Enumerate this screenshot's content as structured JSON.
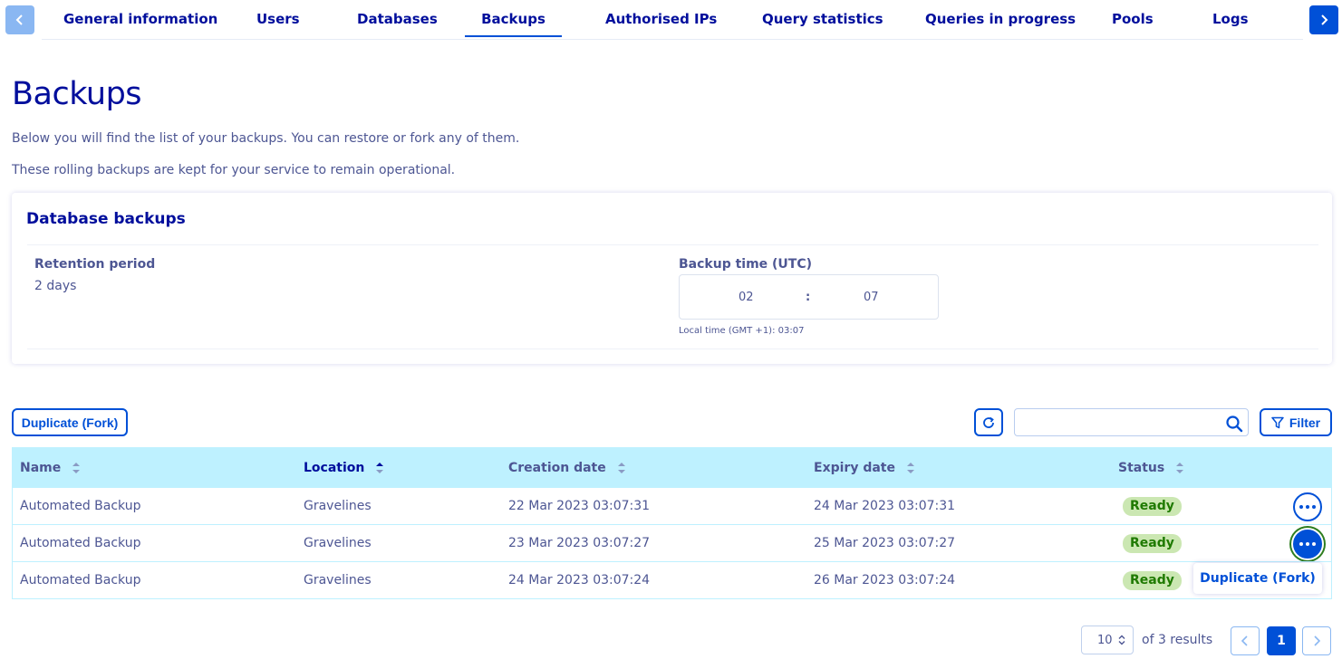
{
  "tabs": [
    "General information",
    "Users",
    "Databases",
    "Backups",
    "Authorised IPs",
    "Query statistics",
    "Queries in progress",
    "Pools",
    "Logs"
  ],
  "active_tab": "Backups",
  "page": {
    "title": "Backups",
    "description_1": "Below you will find the list of your backups. You can restore or fork any of them.",
    "description_2": "These rolling backups are kept for your service to remain operational."
  },
  "card": {
    "title": "Database backups",
    "retention_label": "Retention period",
    "retention_value": "2 days",
    "backup_time_label": "Backup time (UTC)",
    "backup_hour": "02",
    "time_separator": ":",
    "backup_minute": "07",
    "local_time": "Local time (GMT +1): 03:07"
  },
  "toolbar": {
    "fork_button": "Duplicate (Fork)",
    "search_placeholder": "",
    "filter_button": "Filter"
  },
  "table": {
    "headers": [
      "Name",
      "Location",
      "Creation date",
      "Expiry date",
      "Status"
    ],
    "sorted_column": "Location",
    "rows": [
      {
        "name": "Automated Backup",
        "location": "Gravelines",
        "created": "22 Mar 2023 03:07:31",
        "expires": "24 Mar 2023 03:07:31",
        "status": "Ready"
      },
      {
        "name": "Automated Backup",
        "location": "Gravelines",
        "created": "23 Mar 2023 03:07:27",
        "expires": "25 Mar 2023 03:07:27",
        "status": "Ready"
      },
      {
        "name": "Automated Backup",
        "location": "Gravelines",
        "created": "24 Mar 2023 03:07:24",
        "expires": "26 Mar 2023 03:07:24",
        "status": "Ready"
      }
    ]
  },
  "popover": {
    "item": "Duplicate (Fork)"
  },
  "pagination": {
    "page_size": "10",
    "results": "of 3 results",
    "current_page": "1"
  },
  "colors": {
    "primary": "#0050d7",
    "heading": "#000e9c",
    "text": "#4d5693",
    "table_header": "#bef1ff",
    "badge_bg": "#cbe7b2",
    "badge_text": "#1f7a00"
  },
  "icons": {
    "prev_tabs": "chevron-left-icon",
    "next_tabs": "chevron-right-icon",
    "refresh": "refresh-icon",
    "search": "search-icon",
    "filter": "filter-icon",
    "sort": "sort-icon",
    "more": "more-icon"
  }
}
